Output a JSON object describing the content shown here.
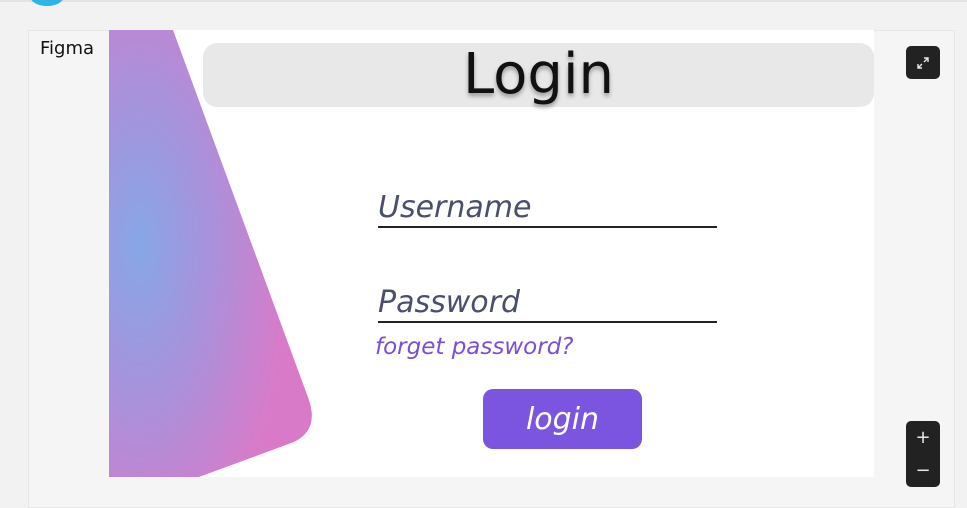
{
  "embed": {
    "label": "Figma"
  },
  "frame": {
    "title": "Login",
    "username_placeholder": "Username",
    "password_placeholder": "Password",
    "forget_link": "forget password?",
    "login_button": "login"
  },
  "controls": {
    "expand_icon": "expand-arrows-icon",
    "zoom_in_label": "+",
    "zoom_out_label": "−"
  },
  "colors": {
    "accent": "#7b55e0",
    "link": "#7a4fd6",
    "gradient_pink": "#d97ac8",
    "gradient_blue": "#86a7e6",
    "title_bar": "#e8e8e8",
    "control_bg": "#222222"
  }
}
